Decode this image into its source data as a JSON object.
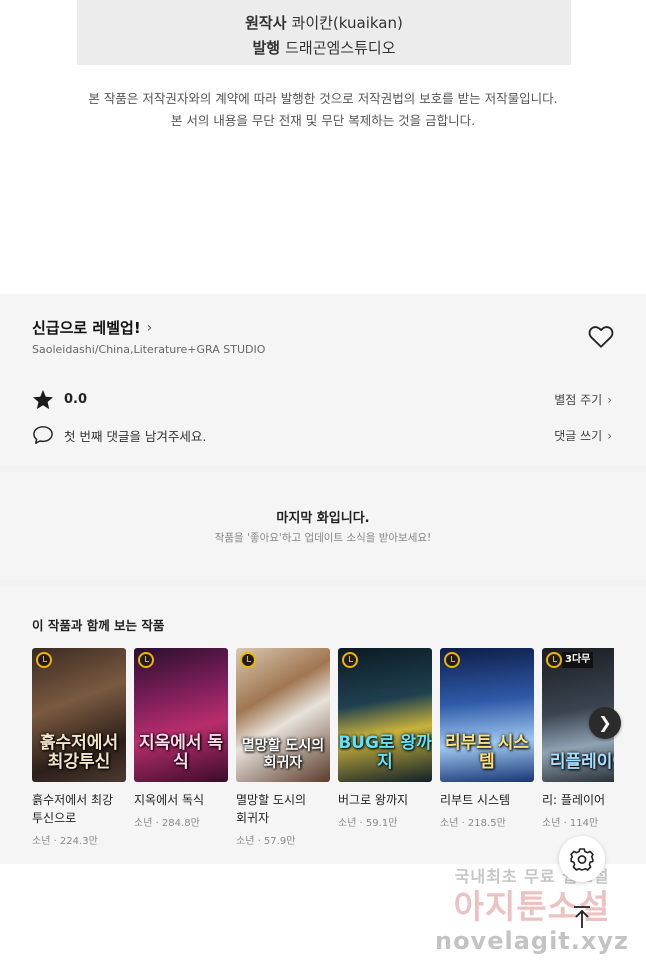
{
  "credits": [
    {
      "label": "원작사",
      "value": "콰이칸(kuaikan)"
    },
    {
      "label": "발행",
      "value": "드래곤엠스튜디오"
    }
  ],
  "notice": {
    "line1": "본 작품은 저작권자와의 계약에 따라 발행한 것으로 저작권법의 보호를 받는 저작물입니다.",
    "line2": "본 서의 내용을 무단 전재 및 무단 복제하는 것을 금합니다."
  },
  "work": {
    "title": "신급으로 레벨업!",
    "authors": "Saoleidashi/China,Literature+GRA STUDIO",
    "rating": "0.0",
    "rate_link": "별점 주기",
    "comment_prompt": "첫 번째 댓글을 남겨주세요.",
    "comment_link": "댓글 쓰기"
  },
  "last_episode": {
    "title": "마지막 화입니다.",
    "subtitle": "작품을 '좋아요'하고 업데이트 소식을 받아보세요!"
  },
  "recommendations": {
    "title": "이 작품과 함께 보는 작품",
    "items": [
      {
        "name": "흙수저에서 최강 투신으로",
        "meta": "소년 · 224.3만",
        "cover_text": "흙수저에서 최강투신",
        "badge": ""
      },
      {
        "name": "지옥에서 독식",
        "meta": "소년 · 284.8만",
        "cover_text": "지옥에서 독식",
        "badge": ""
      },
      {
        "name": "멸망할 도시의 회귀자",
        "meta": "소년 · 57.9만",
        "cover_text": "멸망할 도시의 회귀자",
        "badge": ""
      },
      {
        "name": "버그로 왕까지",
        "meta": "소년 · 59.1만",
        "cover_text": "BUG로 왕까지",
        "badge": ""
      },
      {
        "name": "리부트 시스템",
        "meta": "소년 · 218.5만",
        "cover_text": "리부트 시스템",
        "badge": ""
      },
      {
        "name": "리: 플레이어",
        "meta": "소년 · 114만",
        "cover_text": "리플레이어",
        "badge": "3다무"
      }
    ]
  },
  "watermark": {
    "line1": "국내최초 무료 웹소설",
    "line2": "아지툰소설",
    "line3": "novelagit.xyz"
  },
  "colors": {
    "band": "#f5f5f5",
    "clock_ring": "#f0b400",
    "watermark_pink": "#e9b7b7"
  }
}
